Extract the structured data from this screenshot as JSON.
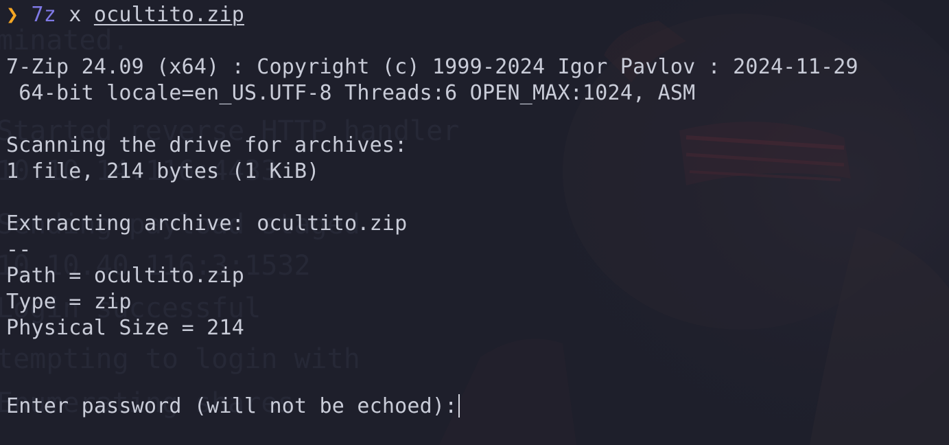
{
  "terminal": {
    "prompt": {
      "symbol": "❯",
      "command": "7z",
      "subcommand": "x",
      "filename": "ocultito.zip"
    },
    "lines": {
      "version": "7-Zip 24.09 (x64) : Copyright (c) 1999-2024 Igor Pavlov : 2024-11-29",
      "locale": " 64-bit locale=en_US.UTF-8 Threads:6 OPEN_MAX:1024, ASM",
      "scanning": "Scanning the drive for archives:",
      "file_count": "1 file, 214 bytes (1 KiB)",
      "extracting": "Extracting archive: ocultito.zip",
      "separator": "--",
      "path": "Path = ocultito.zip",
      "type": "Type = zip",
      "physical_size": "Physical Size = 214",
      "password_prompt": "Enter password (will not be echoed):"
    }
  },
  "colors": {
    "background": "#1e1f2b",
    "foreground": "#c9ccd8",
    "prompt_symbol": "#f5a623",
    "command": "#7f79e6"
  }
}
